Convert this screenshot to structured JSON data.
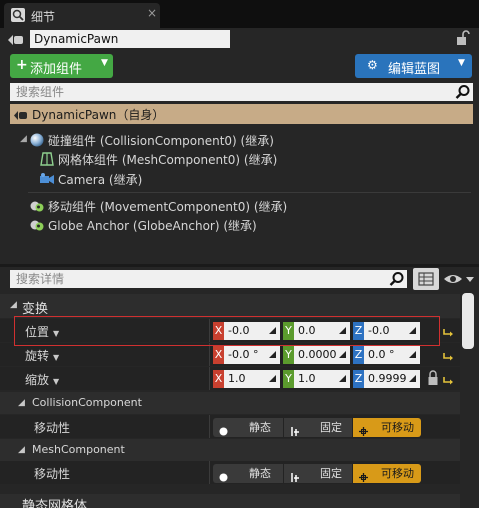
{
  "tab": {
    "title": "细节",
    "close": "×"
  },
  "actor": {
    "name": "DynamicPawn"
  },
  "toolbar": {
    "add_component": "添加组件",
    "edit_blueprint": "编辑蓝图"
  },
  "search_components": {
    "placeholder": "搜索组件"
  },
  "tree": {
    "root": "DynamicPawn（自身）",
    "items": [
      {
        "label": "碰撞组件 (CollisionComponent0) (继承)",
        "icon": "sphere-icon"
      },
      {
        "label": "网格体组件 (MeshComponent0) (继承)",
        "icon": "mesh-icon"
      },
      {
        "label": "Camera (继承)",
        "icon": "camera-icon"
      },
      {
        "label": "移动组件 (MovementComponent0) (继承)",
        "icon": "movement-icon"
      },
      {
        "label": "Globe Anchor (GlobeAnchor) (继承)",
        "icon": "movement-icon"
      }
    ]
  },
  "search_details": {
    "placeholder": "搜索详情"
  },
  "details": {
    "transform": {
      "label": "变换",
      "location": {
        "label": "位置",
        "x": "-0.0",
        "y": "0.0",
        "z": "-0.0"
      },
      "rotation": {
        "label": "旋转",
        "x": "-0.0 °",
        "y": "0.0000",
        "z": "0.0 °"
      },
      "scale": {
        "label": "缩放",
        "x": "1.0",
        "y": "1.0",
        "z": "0.9999"
      }
    },
    "collision_component": {
      "label": "CollisionComponent",
      "mobility": {
        "label": "移动性",
        "static": "静态",
        "stationary": "固定",
        "movable": "可移动",
        "selected": "可移动"
      }
    },
    "mesh_component": {
      "label": "MeshComponent",
      "mobility": {
        "label": "移动性",
        "static": "静态",
        "stationary": "固定",
        "movable": "可移动",
        "selected": "可移动"
      }
    },
    "next_category": "静态网格体"
  },
  "axes": {
    "x": "X",
    "y": "Y",
    "z": "Z"
  },
  "colors": {
    "add_button": "#44a844",
    "blueprint_button": "#2a74bc",
    "root_row": "#c7ab87",
    "axis_x": "#c8402f",
    "axis_y": "#5b9b2d",
    "axis_z": "#2d72c2",
    "movable": "#d89a18",
    "highlight": "#d03030"
  }
}
